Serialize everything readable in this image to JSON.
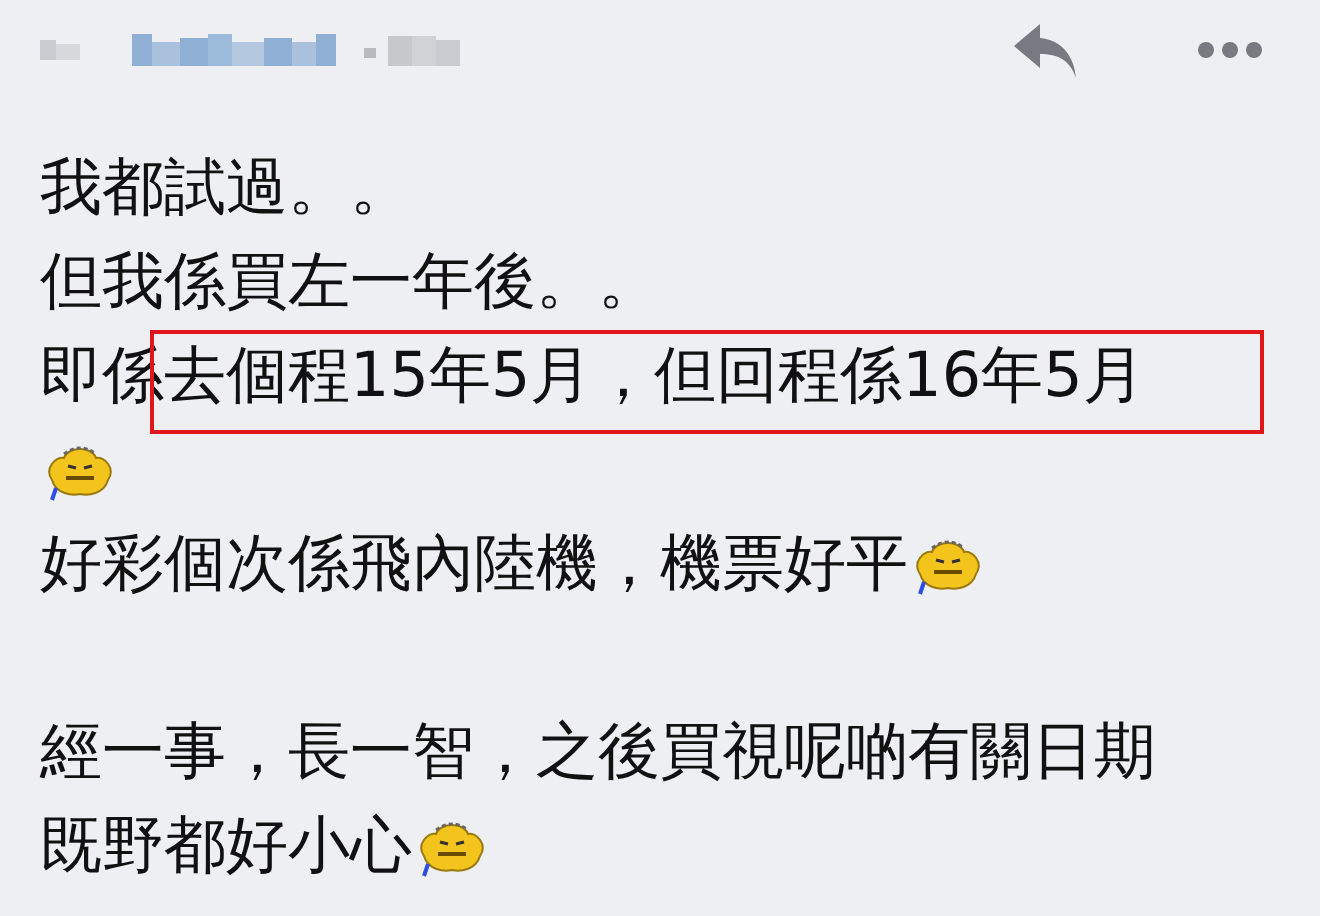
{
  "header": {
    "author_obscured": true
  },
  "lines": [
    {
      "highlighted": false,
      "parts": [
        {
          "kind": "text",
          "text": "我都試過。。"
        }
      ]
    },
    {
      "highlighted": false,
      "parts": [
        {
          "kind": "text",
          "text": "但我係買左一年後。。"
        }
      ]
    },
    {
      "highlighted": true,
      "parts": [
        {
          "kind": "text",
          "text": "即係去個程15年5月，但回程係16年5月"
        }
      ]
    },
    {
      "highlighted": false,
      "parts": [
        {
          "kind": "emoticon"
        }
      ]
    },
    {
      "highlighted": false,
      "parts": [
        {
          "kind": "text",
          "text": "好彩個次係飛內陸機，機票好平"
        },
        {
          "kind": "emoticon"
        }
      ]
    },
    {
      "kind": "blank"
    },
    {
      "highlighted": false,
      "parts": [
        {
          "kind": "text",
          "text": "經一事，長一智，之後買視呢啲有關日期"
        }
      ]
    },
    {
      "highlighted": false,
      "parts": [
        {
          "kind": "text",
          "text": "既野都好小心"
        },
        {
          "kind": "emoticon"
        }
      ]
    }
  ]
}
